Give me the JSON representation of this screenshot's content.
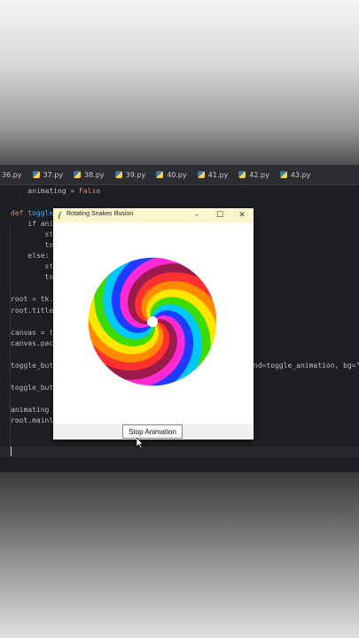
{
  "editor": {
    "tabs": [
      {
        "label": "36.py"
      },
      {
        "label": "37.py"
      },
      {
        "label": "38.py"
      },
      {
        "label": "39.py"
      },
      {
        "label": "40.py"
      },
      {
        "label": "41.py"
      },
      {
        "label": "42.py"
      },
      {
        "label": "43.py"
      }
    ],
    "code_lines": {
      "l1": "    animating = ",
      "l1b": "False",
      "l2a": "def ",
      "l2b": "toggle",
      "l3": "    if ani",
      "l4": "        st",
      "l5": "        to",
      "l6": "    else:",
      "l7": "        st",
      "l8": "        to",
      "l9": "root = tk.",
      "l10": "root.title",
      "l11": "canvas = t",
      "l12": "canvas.pac",
      "l13a": "toggle_butt",
      "l13b": "nd=toggle_animation, bg=\"wh",
      "l14": "toggle_butt",
      "l15": "animating ",
      "l16": "root.mainlo"
    }
  },
  "window": {
    "title": "Rotating Snakes Illusion",
    "minimize": "–",
    "maximize": "☐",
    "close": "✕",
    "button_label": "Stop Animation"
  },
  "palette": {
    "colors": [
      "#ff3030",
      "#ff8a00",
      "#ffe600",
      "#3ddc00",
      "#00c8ff",
      "#1e3cff",
      "#ff2ad4",
      "#9b1b4a"
    ],
    "center_color": "#ffffff"
  },
  "icons": [
    "python-file-icon",
    "tk-feather-icon",
    "mouse-pointer-icon"
  ]
}
